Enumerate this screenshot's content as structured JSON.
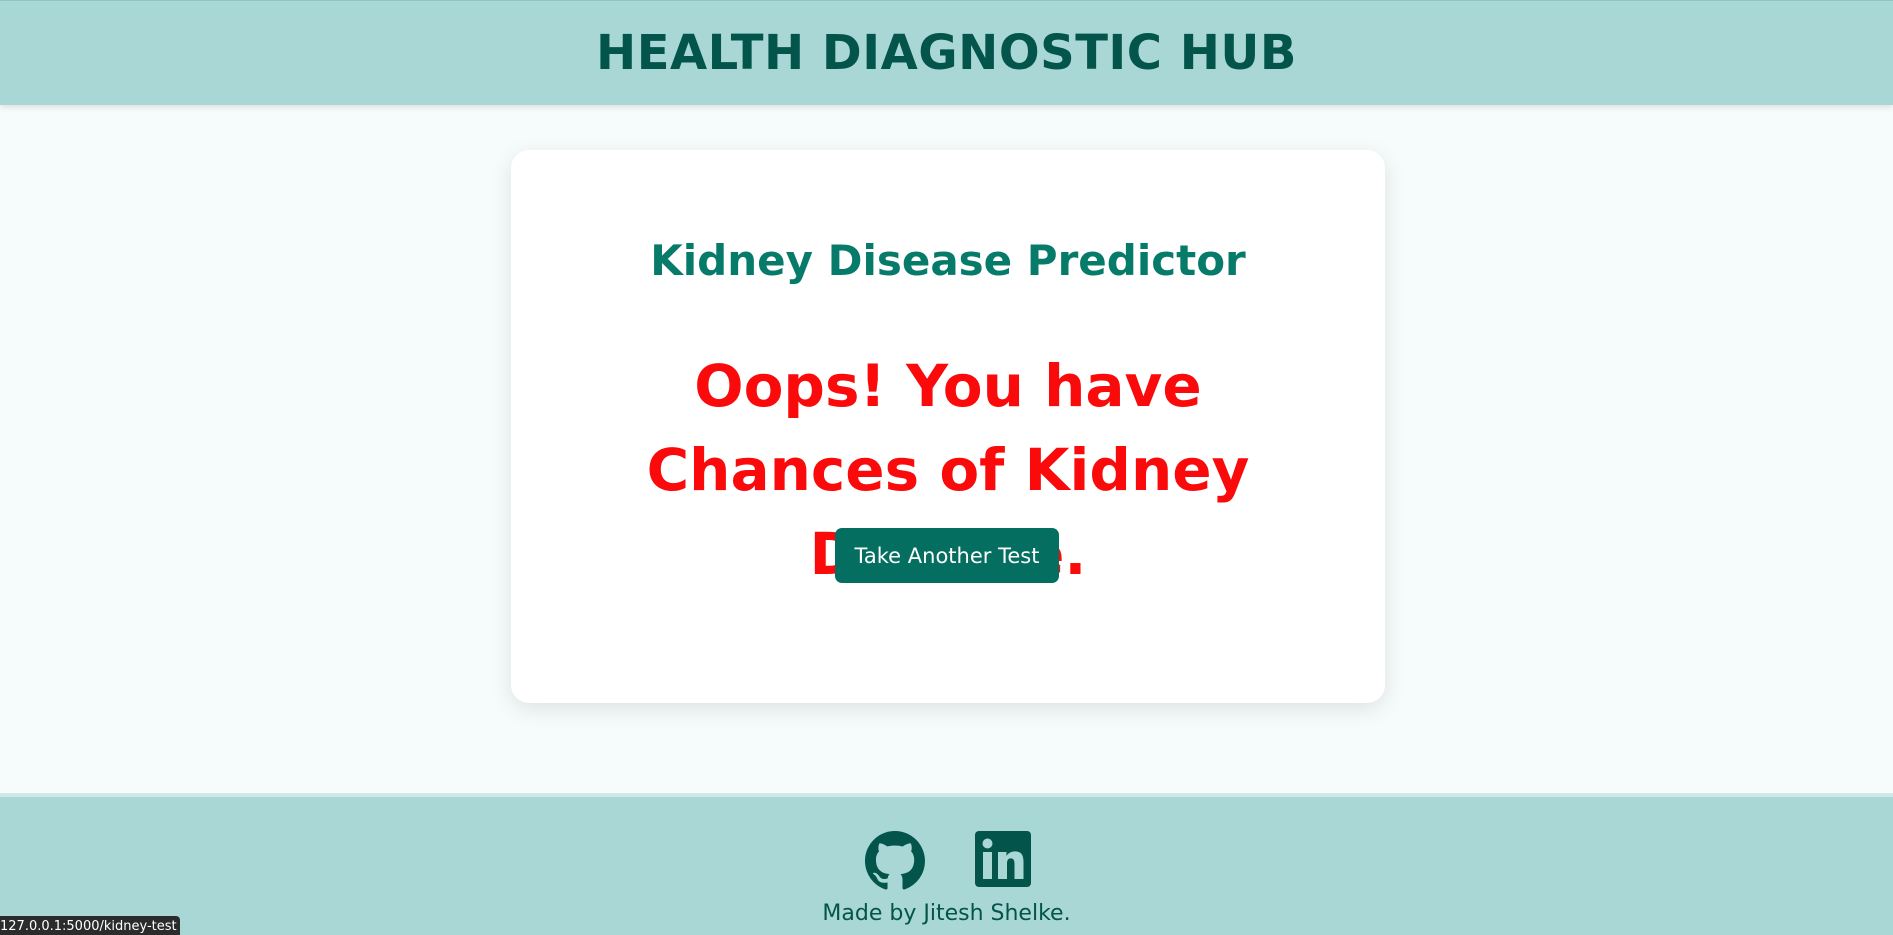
{
  "header": {
    "title": "HEALTH DIAGNOSTIC HUB"
  },
  "card": {
    "title": "Kidney Disease Predictor",
    "result": "Oops! You have Chances of Kidney Disease.",
    "button_label": "Take Another Test"
  },
  "footer": {
    "credit": "Made by Jitesh Shelke.",
    "icons": [
      "github-icon",
      "linkedin-icon"
    ]
  },
  "status_bar": {
    "url": "127.0.0.1:5000/kidney-test"
  },
  "colors": {
    "header_bg": "#a9d7d6",
    "header_text": "#03544a",
    "title_teal": "#077b6a",
    "result_red": "#fa0a0a",
    "button_bg": "#046f61"
  }
}
